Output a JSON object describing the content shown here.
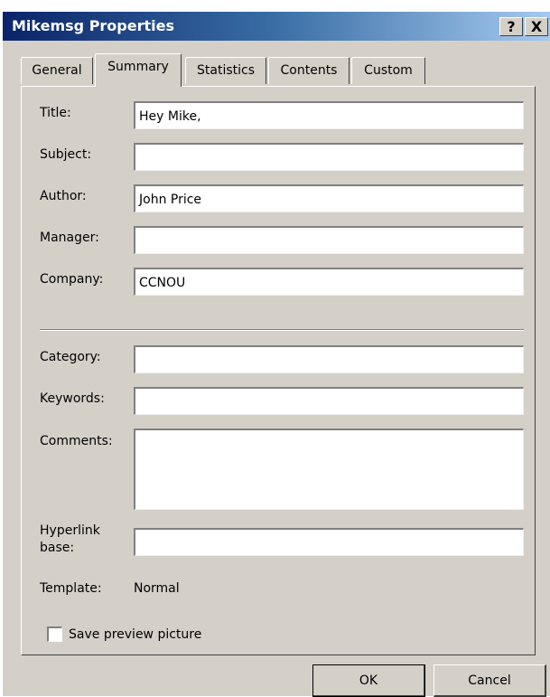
{
  "window": {
    "title": "Mikemsg Properties",
    "help_label": "?",
    "close_label": "X"
  },
  "tabs": [
    {
      "label": "General",
      "active": false
    },
    {
      "label": "Summary",
      "active": true
    },
    {
      "label": "Statistics",
      "active": false
    },
    {
      "label": "Contents",
      "active": false
    },
    {
      "label": "Custom",
      "active": false
    }
  ],
  "fields": {
    "title": {
      "label": "Title:",
      "value": "Hey Mike,"
    },
    "subject": {
      "label": "Subject:",
      "value": ""
    },
    "author": {
      "label": "Author:",
      "value": "John Price"
    },
    "manager": {
      "label": "Manager:",
      "value": ""
    },
    "company": {
      "label": "Company:",
      "value": "CCNOU"
    },
    "category": {
      "label": "Category:",
      "value": ""
    },
    "keywords": {
      "label": "Keywords:",
      "value": ""
    },
    "comments": {
      "label": "Comments:",
      "value": ""
    },
    "hyperlink_base": {
      "label_line1": "Hyperlink",
      "label_line2": "base:",
      "value": ""
    }
  },
  "template": {
    "label": "Template:",
    "value": "Normal"
  },
  "save_preview": {
    "label": "Save preview picture",
    "checked": false
  },
  "buttons": {
    "ok": "OK",
    "cancel": "Cancel"
  },
  "colors": {
    "titlebar_start": "#0a246a",
    "titlebar_end": "#a6caf0",
    "face": "#d4d0c8"
  }
}
